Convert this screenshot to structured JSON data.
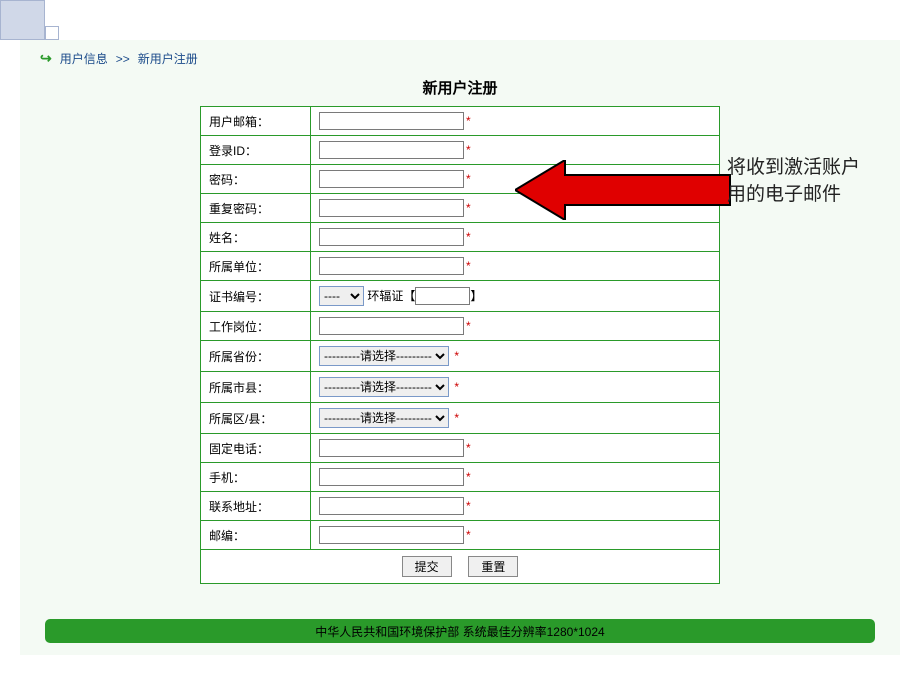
{
  "breadcrumb": {
    "item1": "用户信息",
    "sep": ">>",
    "item2": "新用户注册"
  },
  "page_title": "新用户注册",
  "annotation": {
    "line1": "将收到激活账户",
    "line2": "用的电子邮件"
  },
  "form": {
    "rows": {
      "email_label": "用户邮箱：",
      "login_label": "登录ID：",
      "password_label": "密码：",
      "repassword_label": "重复密码：",
      "name_label": "姓名：",
      "unit_label": "所属单位：",
      "cert_label": "证书编号：",
      "cert_text1": "环辐证【",
      "cert_text2": "】",
      "job_label": "工作岗位：",
      "province_label": "所属省份：",
      "city_label": "所属市县：",
      "district_label": "所属区/县：",
      "phone_label": "固定电话：",
      "mobile_label": "手机：",
      "address_label": "联系地址：",
      "postcode_label": "邮编："
    },
    "select_default": "----",
    "select_placeholder": "---------请选择---------",
    "asterisk": "*",
    "submit_btn": "提交",
    "reset_btn": "重置"
  },
  "footer": "中华人民共和国环境保护部  系统最佳分辨率1280*1024"
}
